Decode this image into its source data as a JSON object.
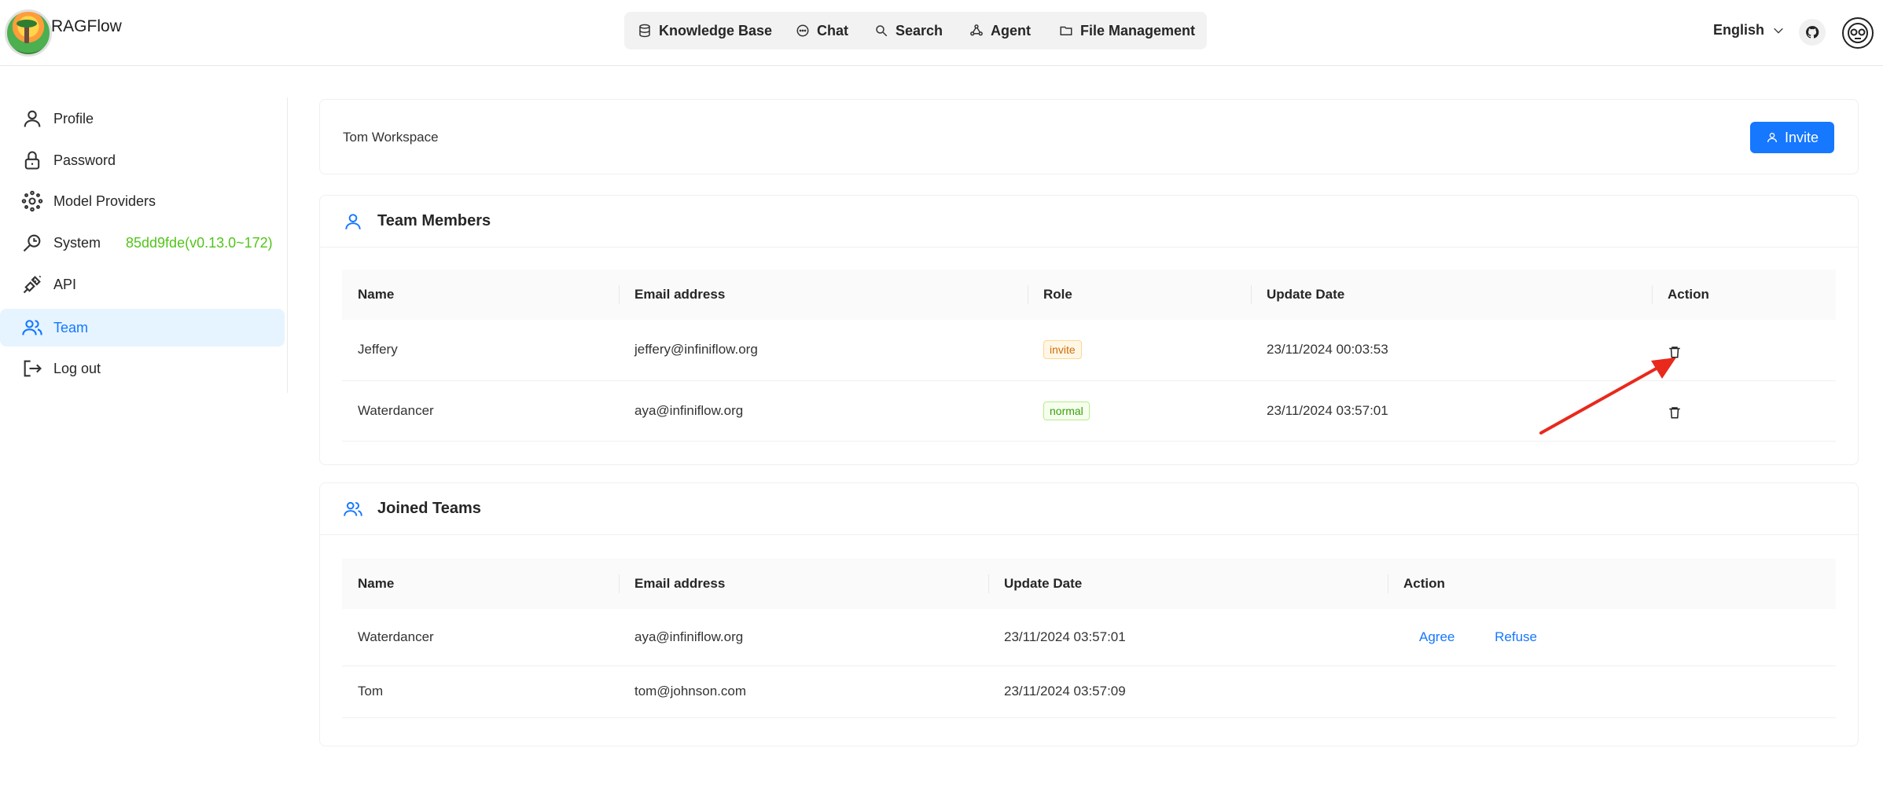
{
  "app": {
    "name": "RAGFlow"
  },
  "nav": {
    "items": [
      {
        "label": "Knowledge Base",
        "icon": "database-icon"
      },
      {
        "label": "Chat",
        "icon": "chat-icon"
      },
      {
        "label": "Search",
        "icon": "search-icon"
      },
      {
        "label": "Agent",
        "icon": "agent-icon"
      },
      {
        "label": "File Management",
        "icon": "folder-icon"
      }
    ]
  },
  "header": {
    "language": "English"
  },
  "sidebar": {
    "items": [
      {
        "label": "Profile",
        "icon": "user-icon"
      },
      {
        "label": "Password",
        "icon": "lock-icon"
      },
      {
        "label": "Model Providers",
        "icon": "model-icon"
      },
      {
        "label": "System",
        "icon": "system-icon"
      },
      {
        "label": "API",
        "icon": "api-icon"
      },
      {
        "label": "Team",
        "icon": "team-icon"
      },
      {
        "label": "Log out",
        "icon": "logout-icon"
      }
    ],
    "version": "85dd9fde(v0.13.0~172)",
    "active": "Team"
  },
  "workspace": {
    "title": "Tom Workspace",
    "invite_label": "Invite"
  },
  "members": {
    "title": "Team Members",
    "columns": [
      "Name",
      "Email address",
      "Role",
      "Update Date",
      "Action"
    ],
    "rows": [
      {
        "name": "Jeffery",
        "email": "jeffery@infiniflow.org",
        "role": "invite",
        "date": "23/11/2024 00:03:53"
      },
      {
        "name": "Waterdancer",
        "email": "aya@infiniflow.org",
        "role": "normal",
        "date": "23/11/2024 03:57:01"
      }
    ]
  },
  "joined": {
    "title": "Joined Teams",
    "columns": [
      "Name",
      "Email address",
      "Update Date",
      "Action"
    ],
    "rows": [
      {
        "name": "Waterdancer",
        "email": "aya@infiniflow.org",
        "date": "23/11/2024 03:57:01",
        "agree": "Agree",
        "refuse": "Refuse"
      },
      {
        "name": "Tom",
        "email": "tom@johnson.com",
        "date": "23/11/2024 03:57:09"
      }
    ]
  },
  "colors": {
    "accent": "#1677ff",
    "version": "#52c41a",
    "annotation_arrow": "#e8291c"
  }
}
